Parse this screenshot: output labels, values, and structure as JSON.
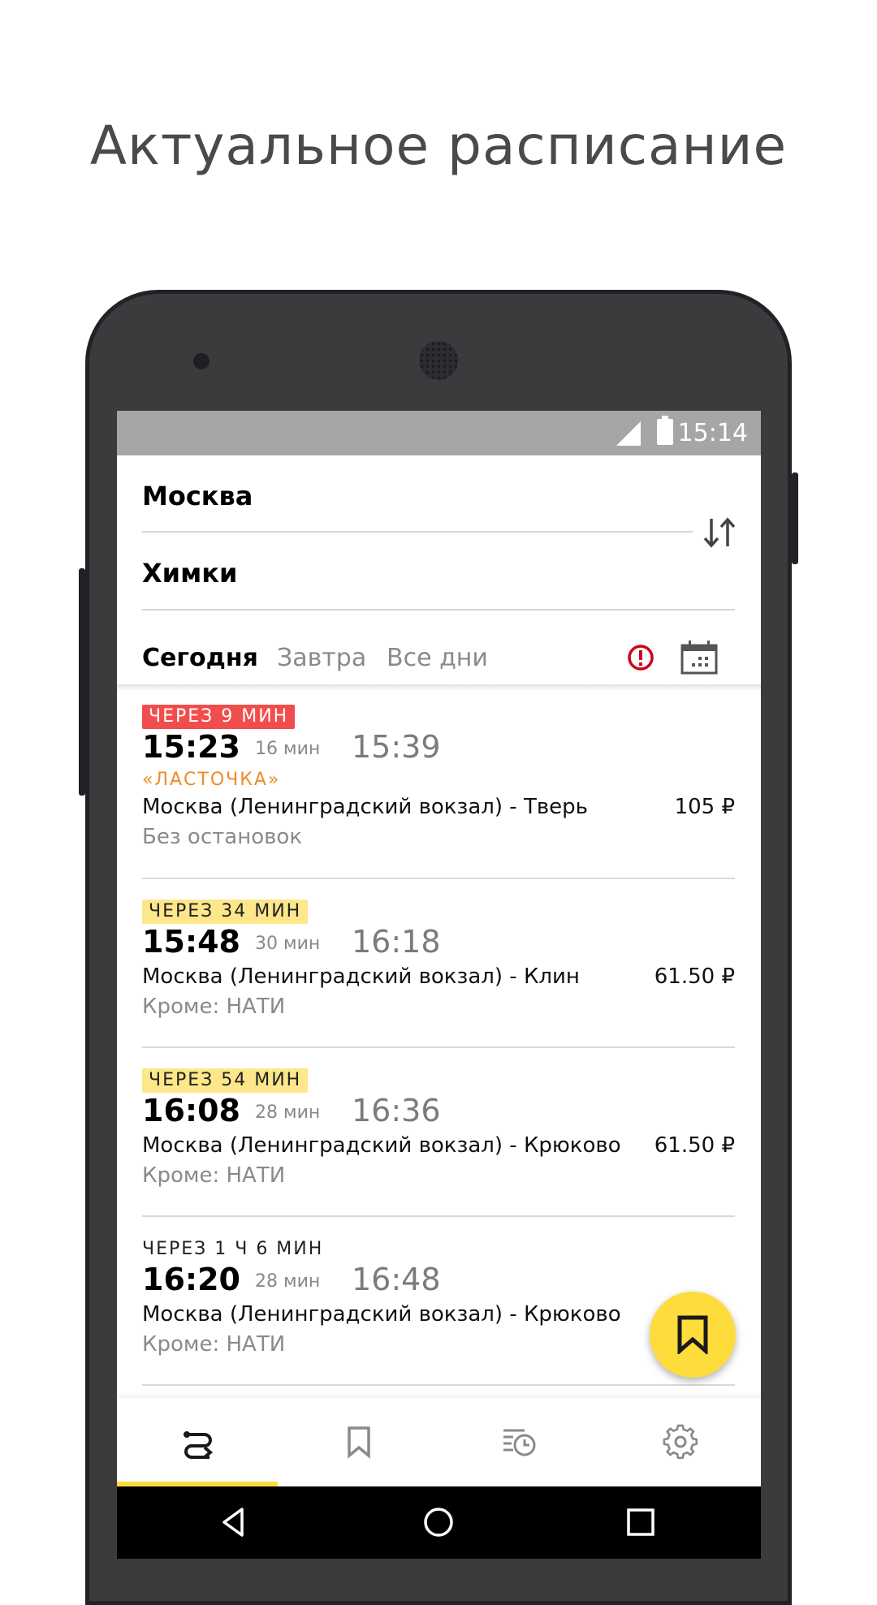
{
  "promo": {
    "title": "Актуальное расписание"
  },
  "status_bar": {
    "time": "15:14"
  },
  "route": {
    "from": "Москва",
    "to": "Химки"
  },
  "date_tabs": [
    {
      "label": "Сегодня",
      "selected": true
    },
    {
      "label": "Завтра",
      "selected": false
    },
    {
      "label": "Все дни",
      "selected": false
    }
  ],
  "trips": [
    {
      "countdown": "ЧЕРЕЗ 9 МИН",
      "badge_style": "red",
      "departure": "15:23",
      "duration": "16 мин",
      "arrival": "15:39",
      "brand": "«ЛАСТОЧКА»",
      "route": "Москва (Ленинградский вокзал) - Тверь",
      "price": "105 ₽",
      "note": "Без остановок"
    },
    {
      "countdown": "ЧЕРЕЗ 34 МИН",
      "badge_style": "yellow",
      "departure": "15:48",
      "duration": "30 мин",
      "arrival": "16:18",
      "route": "Москва (Ленинградский вокзал) - Клин",
      "price": "61.50 ₽",
      "note": "Кроме: НАТИ"
    },
    {
      "countdown": "ЧЕРЕЗ 54 МИН",
      "badge_style": "yellow",
      "departure": "16:08",
      "duration": "28 мин",
      "arrival": "16:36",
      "route": "Москва (Ленинградский вокзал) - Крюково",
      "price": "61.50 ₽",
      "note": "Кроме: НАТИ"
    },
    {
      "countdown": "ЧЕРЕЗ 1 Ч 6 МИН",
      "badge_style": "plain",
      "departure": "16:20",
      "duration": "28 мин",
      "arrival": "16:48",
      "route": "Москва (Ленинградский вокзал) - Крюково",
      "price": "",
      "note": "Кроме: НАТИ"
    }
  ],
  "icons": {
    "swap": "swap-direction-icon",
    "alert": "alert-icon",
    "calendar": "calendar-icon",
    "fab": "bookmark-icon",
    "nav": [
      "routes-icon",
      "bookmark-icon",
      "history-icon",
      "settings-icon"
    ]
  },
  "colors": {
    "accent": "#fddc3c",
    "badge_red": "#f24d4d",
    "badge_yellow": "#fde78a",
    "brand_orange": "#f08a24",
    "alert_red": "#d0021b"
  },
  "bottom_nav": {
    "active_index": 0
  }
}
